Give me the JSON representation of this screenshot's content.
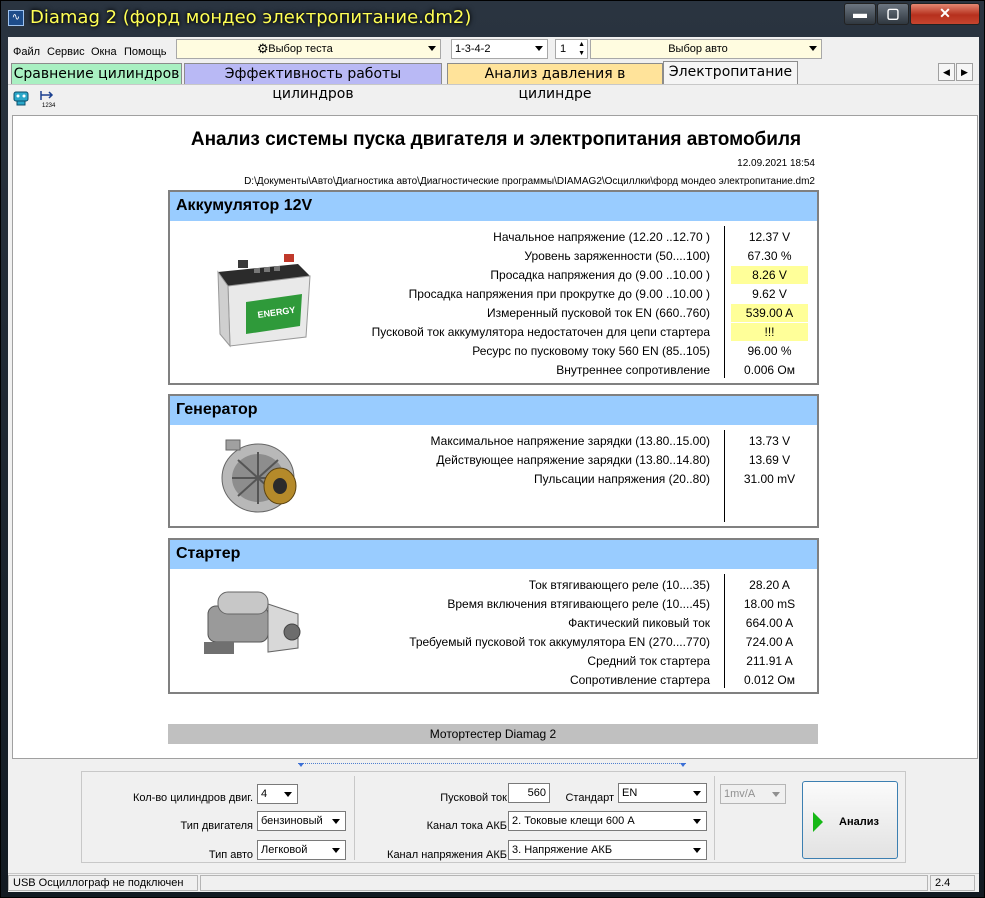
{
  "window": {
    "title": "Diamag 2 (форд мондео электропитание.dm2)",
    "controls": {
      "minimize": "▬",
      "maximize": "▢",
      "close": "✕"
    }
  },
  "menu": {
    "items": [
      "Файл",
      "Сервис",
      "Окна",
      "Помощь"
    ],
    "test_select": "Выбор теста",
    "firing_order": "1-3-4-2",
    "cylinder_spin": "1",
    "car_select": "Выбор авто"
  },
  "tabs": [
    {
      "label": "Сравнение цилиндров",
      "color": "#a9f0c2",
      "active": false
    },
    {
      "label": "Эффективность работы цилиндров",
      "color": "#b9b9f5",
      "active": false
    },
    {
      "label": "Анализ давления в цилиндре",
      "color": "#ffe39a",
      "active": false
    },
    {
      "label": "Электропитание",
      "color": "#f5f5f5",
      "active": true
    }
  ],
  "tab_scroll": {
    "left": "◀",
    "right": "▶"
  },
  "report": {
    "title": "Анализ системы пуска двигателя и электропитания автомобиля",
    "date": "12.09.2021 18:54",
    "path": "D:\\Документы\\Авто\\Диагностика авто\\Диагностические программы\\DIAMAG2\\Осциллки\\форд мондео электропитание.dm2",
    "sections": [
      {
        "title": "Аккумулятор 12V",
        "image_icon": "battery-image",
        "rows": [
          {
            "label": "Начальное напряжение (12.20 ..12.70 )",
            "value": "12.37 V",
            "warn": false
          },
          {
            "label": "Уровень заряженности (50....100)",
            "value": "67.30 %",
            "warn": false
          },
          {
            "label": "Просадка напряжения до (9.00 ..10.00 )",
            "value": "8.26 V",
            "warn": true
          },
          {
            "label": "Просадка напряжения при прокрутке до (9.00 ..10.00 )",
            "value": "9.62 V",
            "warn": false
          },
          {
            "label": "Измеренный пусковой ток  EN (660..760)",
            "value": "539.00 A",
            "warn": true
          },
          {
            "label": "Пусковой ток аккумулятора недостаточен для цепи стартера",
            "value": "!!!",
            "warn": true
          },
          {
            "label": "Ресурс по пусковому току  560 EN (85..105)",
            "value": "96.00 %",
            "warn": false
          },
          {
            "label": "Внутреннее сопротивление",
            "value": "0.006 Ом",
            "warn": false
          }
        ]
      },
      {
        "title": "Генератор",
        "image_icon": "alternator-image",
        "rows": [
          {
            "label": "Максимальное напряжение зарядки  (13.80..15.00)",
            "value": "13.73 V",
            "warn": false
          },
          {
            "label": "Действующее напряжение зарядки (13.80..14.80)",
            "value": "13.69 V",
            "warn": false
          },
          {
            "label": "Пульсации напряжения (20..80)",
            "value": "31.00 mV",
            "warn": false
          }
        ]
      },
      {
        "title": "Стартер",
        "image_icon": "starter-image",
        "rows": [
          {
            "label": "Ток втягивающего реле (10....35)",
            "value": "28.20 A",
            "warn": false
          },
          {
            "label": "Время включения втягивающего реле (10....45)",
            "value": "18.00 mS",
            "warn": false
          },
          {
            "label": "Фактический пиковый ток",
            "value": "664.00 A",
            "warn": false
          },
          {
            "label": "Требуемый пусковой ток аккумулятора  EN (270....770)",
            "value": "724.00 A",
            "warn": false
          },
          {
            "label": "Средний ток стартера",
            "value": "211.91 A",
            "warn": false
          },
          {
            "label": "Сопротивление стартера",
            "value": "0.012 Ом",
            "warn": false
          }
        ]
      }
    ],
    "footer": "Мотортестер Diamag 2"
  },
  "settings": {
    "cylinders_label": "Кол-во цилиндров двиг.",
    "cylinders_value": "4",
    "engine_type_label": "Тип двигателя",
    "engine_type_value": "бензиновый",
    "car_type_label": "Тип авто",
    "car_type_value": "Легковой",
    "start_current_label": "Пусковой ток",
    "start_current_value": "560",
    "standard_label": "Стандарт",
    "standard_value": "EN",
    "current_channel_label": "Канал тока АКБ",
    "current_channel_value": "2.  Токовые клещи 600 А",
    "voltage_channel_label": "Канал напряжения АКБ",
    "voltage_channel_value": "3.  Напряжение АКБ",
    "scale_value": "1mv/A",
    "analyze_label": "Анализ"
  },
  "status": {
    "message": "USB Осциллограф не подключен",
    "version": "2.4"
  }
}
